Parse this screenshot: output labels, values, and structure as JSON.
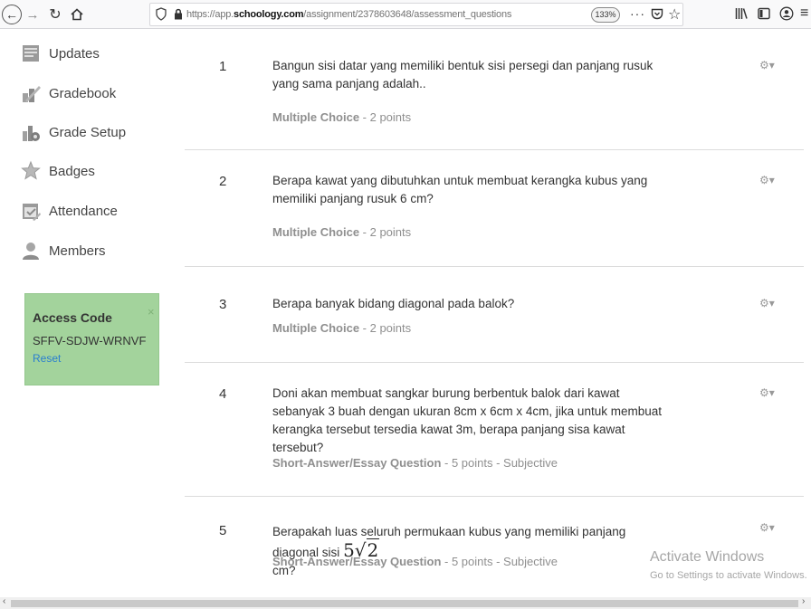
{
  "browser": {
    "url_prefix": "https://app.",
    "url_domain": "schoology.com",
    "url_path": "/assignment/2378603648/assessment_questions",
    "zoom": "133%",
    "more": "···",
    "icons": [
      "back-icon",
      "forward-icon",
      "reload-icon",
      "home-icon",
      "shield-icon",
      "lock-icon",
      "pocket-icon",
      "star-icon",
      "library-icon",
      "sidebar-icon",
      "account-icon",
      "menu-icon"
    ]
  },
  "sidebar": {
    "items": [
      {
        "label": "Updates",
        "icon": "updates-icon"
      },
      {
        "label": "Gradebook",
        "icon": "gradebook-icon"
      },
      {
        "label": "Grade Setup",
        "icon": "grade-setup-icon"
      },
      {
        "label": "Badges",
        "icon": "badge-icon"
      },
      {
        "label": "Attendance",
        "icon": "attendance-icon"
      },
      {
        "label": "Members",
        "icon": "members-icon"
      }
    ],
    "access_code": {
      "title": "Access Code",
      "close": "×",
      "code": "SFFV-SDJW-WRNVF",
      "reset": "Reset"
    }
  },
  "questions": [
    {
      "number": "1",
      "text": "Bangun sisi datar yang memiliki bentuk sisi persegi dan panjang rusuk yang sama panjang adalah..",
      "type": "Multiple Choice",
      "details": " - 2 points"
    },
    {
      "number": "2",
      "text": "Berapa kawat yang dibutuhkan untuk membuat kerangka kubus yang memiliki panjang rusuk 6 cm?",
      "type": "Multiple Choice",
      "details": " - 2 points"
    },
    {
      "number": "3",
      "text": "Berapa banyak bidang diagonal pada balok?",
      "type": "Multiple Choice",
      "details": " - 2 points"
    },
    {
      "number": "4",
      "text": "Doni akan membuat sangkar burung berbentuk balok dari kawat sebanyak 3 buah dengan ukuran 8cm x 6cm x 4cm, jika untuk membuat kerangka tersebut tersedia kawat 3m, berapa panjang sisa kawat tersebut?",
      "type": "Short-Answer/Essay Question",
      "details": " - 5 points - Subjective"
    },
    {
      "number": "5",
      "text": "Berapakah luas seluruh permukaan kubus yang memiliki panjang diagonal sisi",
      "math_coef": "5",
      "math_radicand": "2",
      "text_end": "cm?",
      "type": "Short-Answer/Essay Question",
      "details": " - 5 points - Subjective"
    }
  ],
  "gear_glyph": "⚙▾",
  "watermark": {
    "title": "Activate Windows",
    "subtitle": "Go to Settings to activate Windows."
  },
  "scrollbar": {
    "left": "‹",
    "right": "›"
  }
}
